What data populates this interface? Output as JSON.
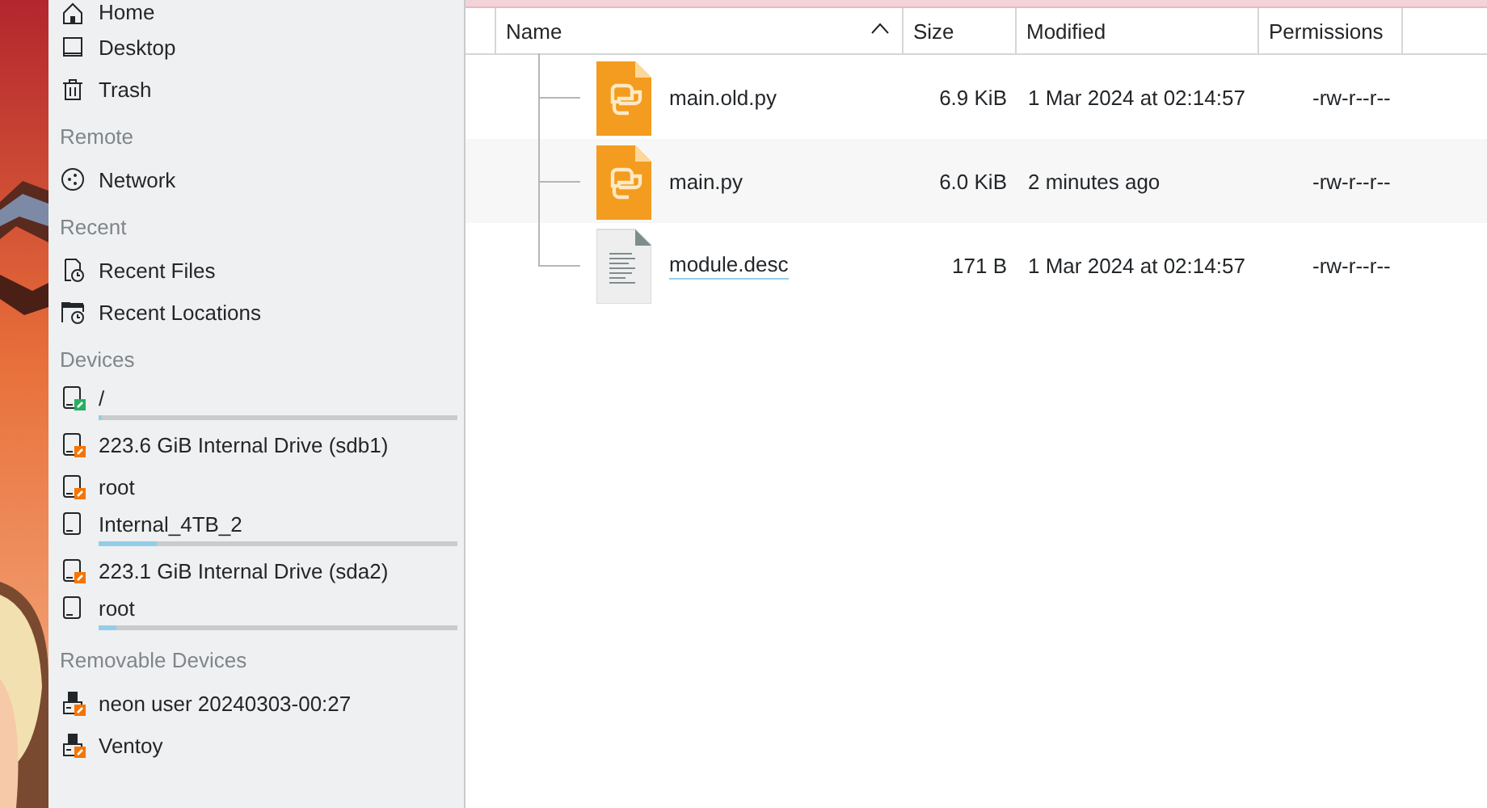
{
  "sidebar": {
    "sections": [
      {
        "kind": "places",
        "items": [
          {
            "label": "Home"
          },
          {
            "label": "Desktop"
          },
          {
            "label": "Trash"
          }
        ]
      },
      {
        "kind": "remote",
        "heading": "Remote",
        "items": [
          {
            "label": "Network"
          }
        ]
      },
      {
        "kind": "recent",
        "heading": "Recent",
        "items": [
          {
            "label": "Recent Files"
          },
          {
            "label": "Recent Locations"
          }
        ]
      },
      {
        "kind": "devices",
        "heading": "Devices",
        "items": [
          {
            "label": "/",
            "color": "#27ae60",
            "level": 0.01
          },
          {
            "label": "223.6 GiB Internal Drive (sdb1)",
            "color": "#f67400"
          },
          {
            "label": "root",
            "color": "#f67400"
          },
          {
            "label": "Internal_4TB_2",
            "level": 0.16
          },
          {
            "label": "223.1 GiB Internal Drive (sda2)",
            "color": "#f67400"
          },
          {
            "label": "root",
            "level": 0.05
          }
        ]
      },
      {
        "kind": "removable",
        "heading": "Removable Devices",
        "items": [
          {
            "label": "neon user 20240303-00:27",
            "color": "#f67400"
          },
          {
            "label": "Ventoy",
            "color": "#f67400"
          }
        ]
      }
    ]
  },
  "table": {
    "columns": [
      {
        "label": "Name",
        "sorted": true
      },
      {
        "label": "Size",
        "sorted": false
      },
      {
        "label": "Modified",
        "sorted": false
      },
      {
        "label": "Permissions",
        "sorted": false
      }
    ],
    "rows": [
      {
        "kind": "python",
        "name": "main.old.py",
        "size": "6.9 KiB",
        "modified": "1 Mar 2024 at 02:14:57",
        "permissions": "-rw-r--r--",
        "hovered": false
      },
      {
        "kind": "python",
        "name": "main.py",
        "size": "6.0 KiB",
        "modified": "2 minutes ago",
        "permissions": "-rw-r--r--",
        "hovered": false
      },
      {
        "kind": "text",
        "name": "module.desc",
        "size": "171 B",
        "modified": "1 Mar 2024 at 02:14:57",
        "permissions": "-rw-r--r--",
        "hovered": true
      }
    ]
  }
}
